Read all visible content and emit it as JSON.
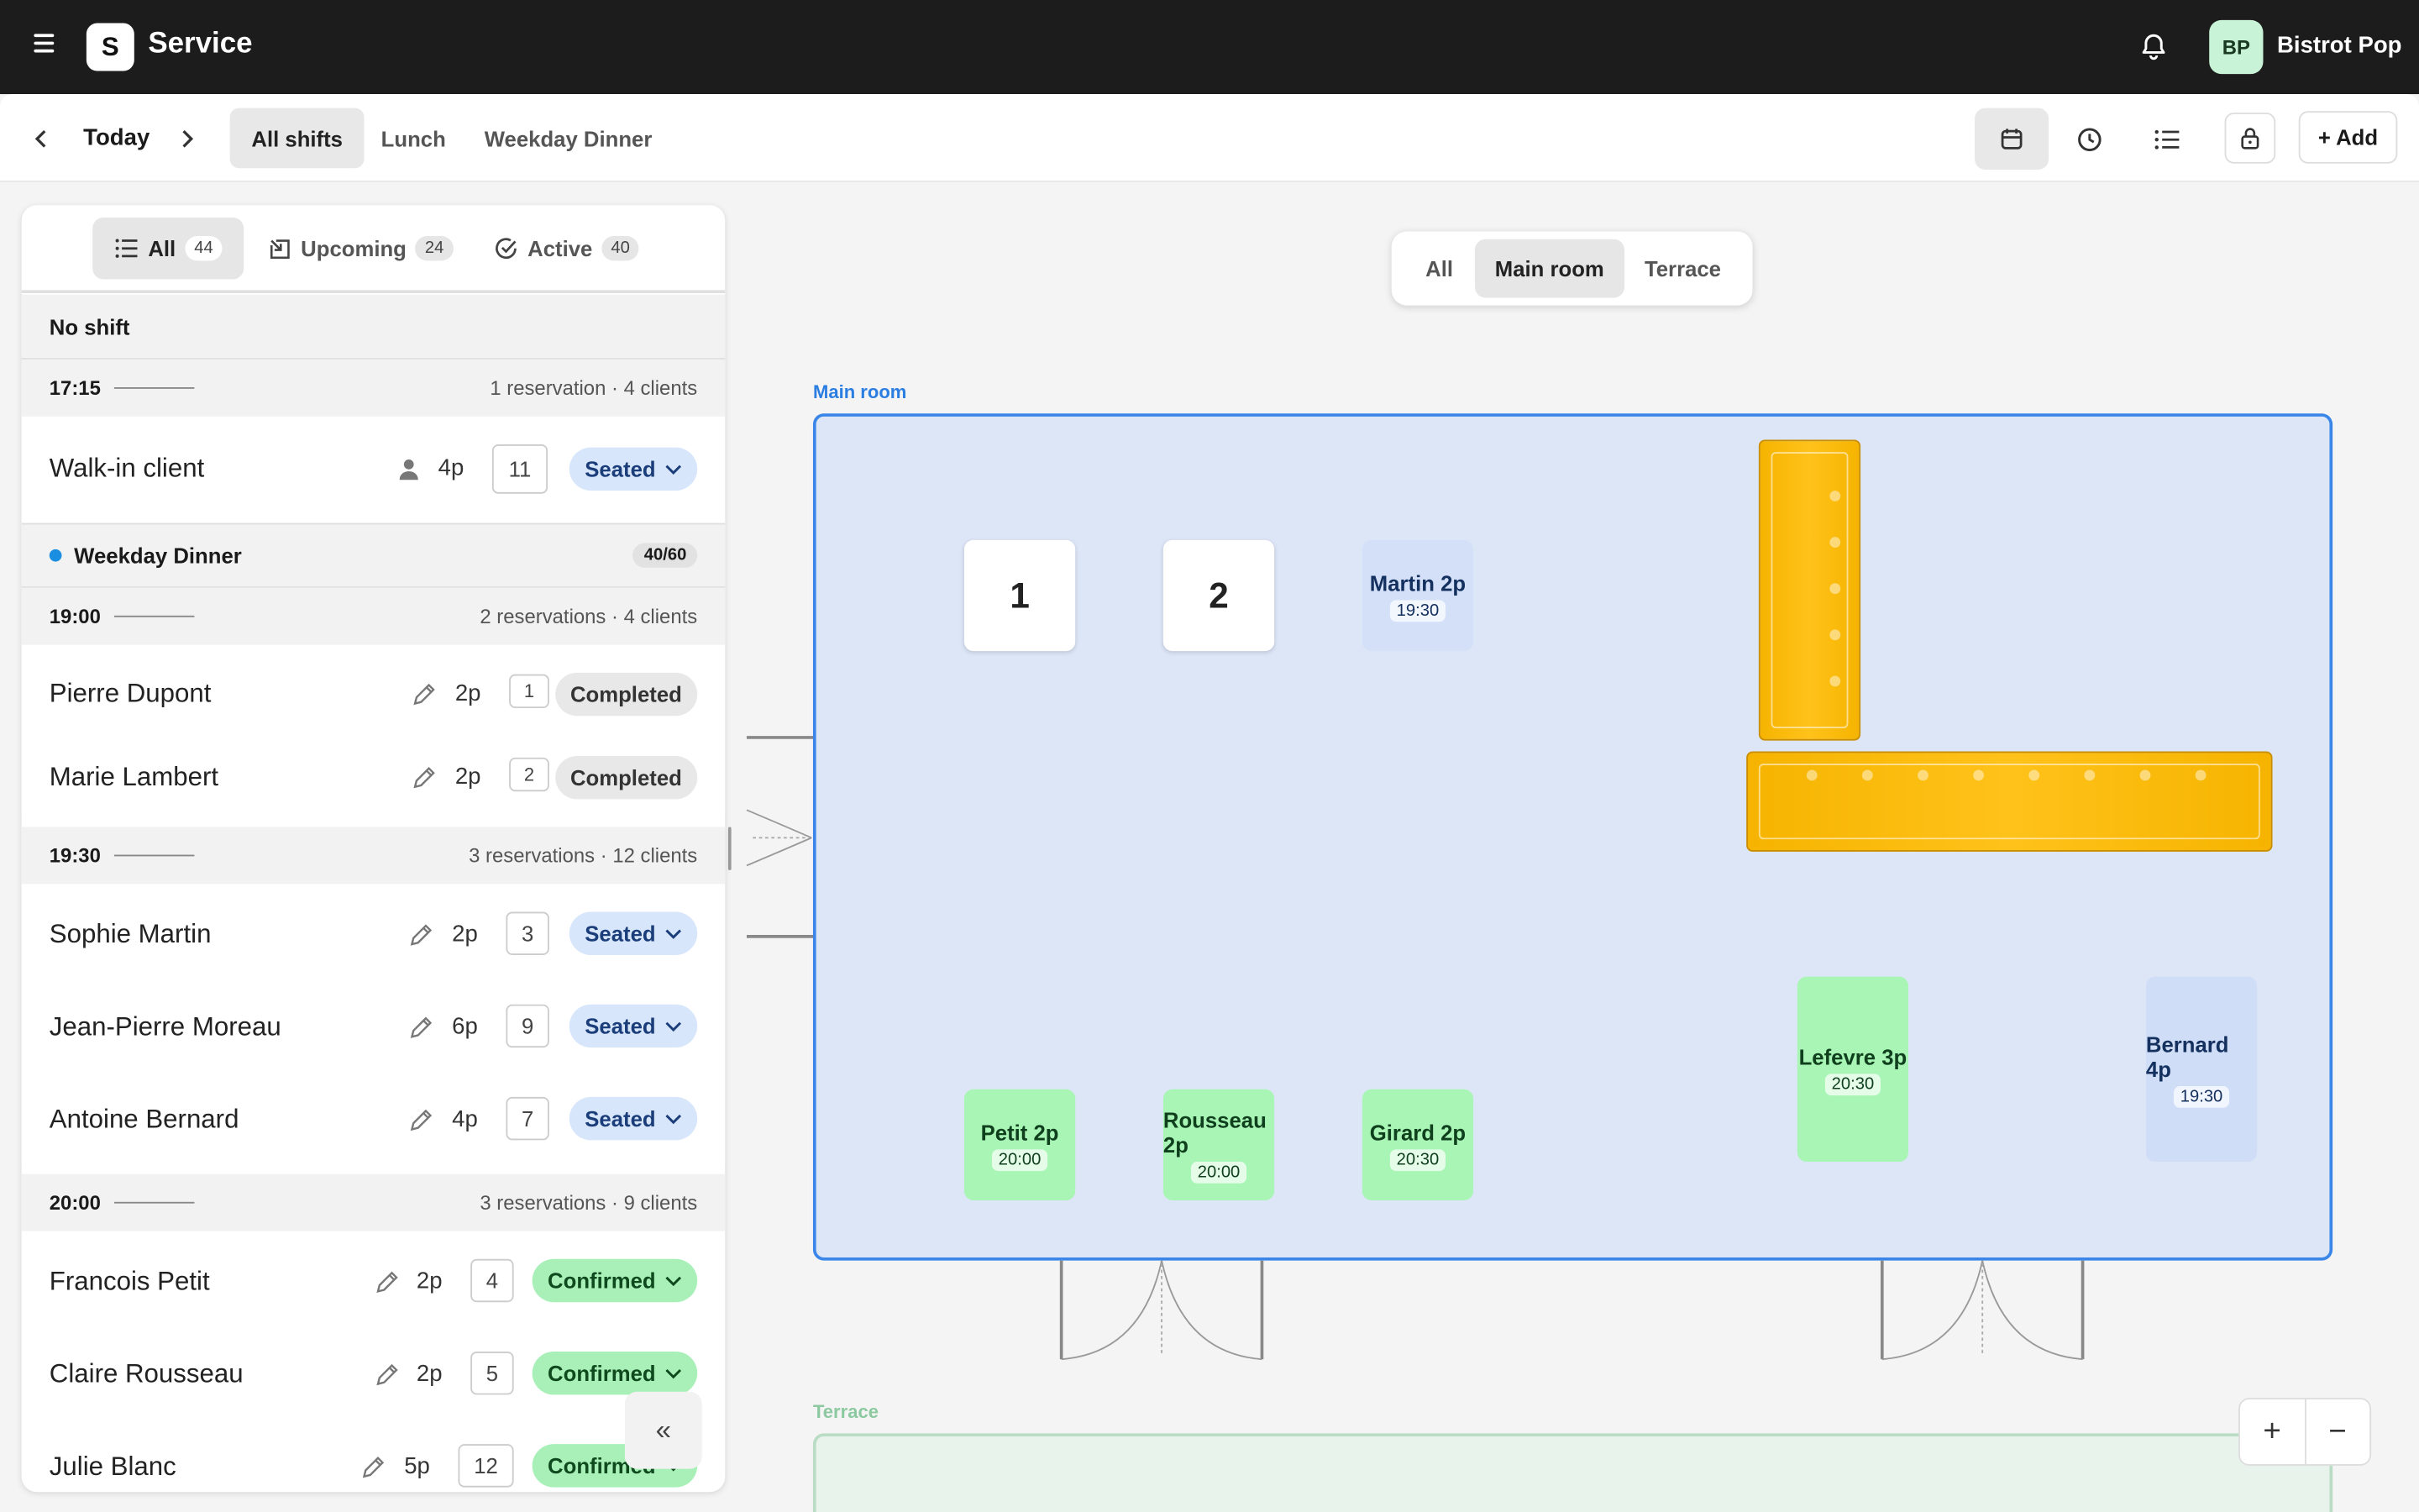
{
  "header": {
    "logo_letter": "S",
    "title": "Service",
    "avatar_initials": "BP",
    "restaurant_name": "Bistrot Pop"
  },
  "subbar": {
    "date_label": "Today",
    "shift_tabs": [
      "All shifts",
      "Lunch",
      "Weekday Dinner"
    ],
    "add_label": "+ Add"
  },
  "filters": [
    {
      "label": "All",
      "count": "44"
    },
    {
      "label": "Upcoming",
      "count": "24"
    },
    {
      "label": "Active",
      "count": "40"
    }
  ],
  "list": {
    "no_shift_label": "No shift",
    "slot_1715": {
      "time": "17:15",
      "summary": "1 reservation · 4 clients"
    },
    "walkin": {
      "name": "Walk-in client",
      "size": "4p",
      "table": "11",
      "status": "Seated"
    },
    "shift": {
      "name": "Weekday Dinner",
      "capacity": "40/60",
      "color": "#1a8ee0"
    },
    "slot_1900": {
      "time": "19:00",
      "summary": "2 reservations · 4 clients"
    },
    "r1900": [
      {
        "name": "Pierre Dupont",
        "size": "2p",
        "table": "1",
        "status": "Completed"
      },
      {
        "name": "Marie Lambert",
        "size": "2p",
        "table": "2",
        "status": "Completed"
      }
    ],
    "slot_1930": {
      "time": "19:30",
      "summary": "3 reservations · 12 clients"
    },
    "r1930": [
      {
        "name": "Sophie Martin",
        "size": "2p",
        "table": "3",
        "status": "Seated"
      },
      {
        "name": "Jean-Pierre Moreau",
        "size": "6p",
        "table": "9",
        "status": "Seated"
      },
      {
        "name": "Antoine Bernard",
        "size": "4p",
        "table": "7",
        "status": "Seated"
      }
    ],
    "slot_2000": {
      "time": "20:00",
      "summary": "3 reservations · 9 clients"
    },
    "r2000": [
      {
        "name": "Francois Petit",
        "size": "2p",
        "table": "4",
        "status": "Confirmed"
      },
      {
        "name": "Claire Rousseau",
        "size": "2p",
        "table": "5",
        "status": "Confirmed"
      },
      {
        "name": "Julie Blanc",
        "size": "5p",
        "table": "12",
        "status": "Confirmed"
      }
    ],
    "collapse_glyph": "«"
  },
  "floor": {
    "room_filters": [
      "All",
      "Main room",
      "Terrace"
    ],
    "main_room_label": "Main room",
    "terrace_label": "Terrace",
    "tables": {
      "t1": "1",
      "t2": "2",
      "martin": {
        "name": "Martin 2p",
        "time": "19:30"
      },
      "petit": {
        "name": "Petit 2p",
        "time": "20:00"
      },
      "rousseau": {
        "name": "Rousseau 2p",
        "time": "20:00"
      },
      "girard": {
        "name": "Girard 2p",
        "time": "20:30"
      },
      "lefevre": {
        "name": "Lefevre 3p",
        "time": "20:30"
      },
      "bernard": {
        "name": "Bernard 4p",
        "time": "19:30"
      }
    },
    "zoom_in": "+",
    "zoom_out": "−"
  },
  "colors": {
    "seated": "#d8e6fb",
    "confirmed": "#a8f0b8",
    "completed": "#e8e8e8",
    "bar": "#f6b400",
    "room_border": "#3a86e8"
  }
}
